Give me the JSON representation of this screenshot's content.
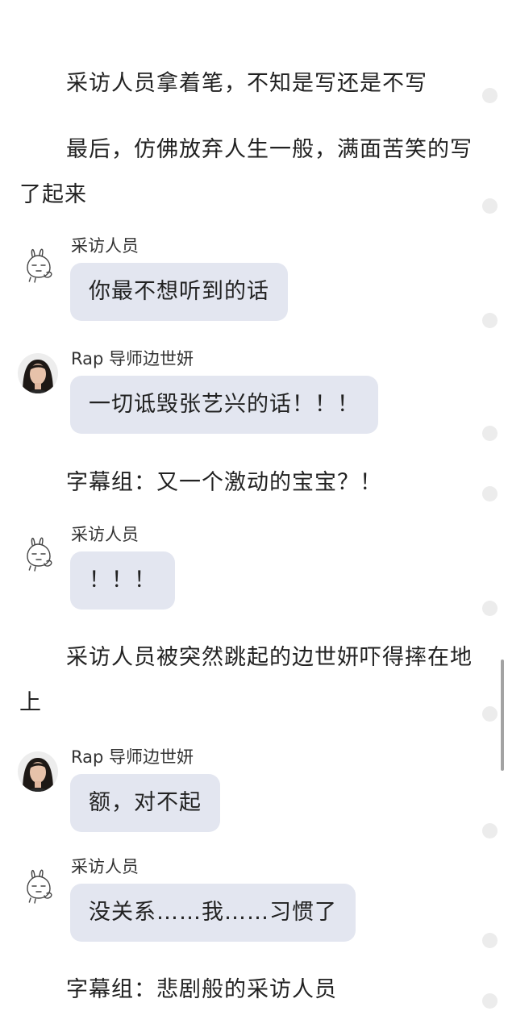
{
  "paragraphs": [
    "采访人员拿着笔，不知是写还是不写",
    "最后，仿佛放弃人生一般，满面苦笑的写了起来",
    "字幕组：又一个激动的宝宝？！",
    "采访人员被突然跳起的边世妍吓得摔在地上",
    "字幕组：悲剧般的采访人员"
  ],
  "messages": [
    {
      "speaker": "采访人员",
      "text": "你最不想听到的话",
      "avatar": "rabbit-doodle-icon"
    },
    {
      "speaker": "Rap 导师边世妍",
      "text": "一切诋毁张艺兴的话！！！",
      "avatar": "woman-portrait"
    },
    {
      "speaker": "采访人员",
      "text": "！！！",
      "avatar": "rabbit-doodle-icon"
    },
    {
      "speaker": "Rap 导师边世妍",
      "text": "额，对不起",
      "avatar": "woman-portrait"
    },
    {
      "speaker": "采访人员",
      "text": "没关系……我……习惯了",
      "avatar": "rabbit-doodle-icon"
    }
  ],
  "colors": {
    "bubble": "#e3e6f0",
    "text": "#222222",
    "dot": "#ececec",
    "scrollbar": "#a3a3a3"
  }
}
